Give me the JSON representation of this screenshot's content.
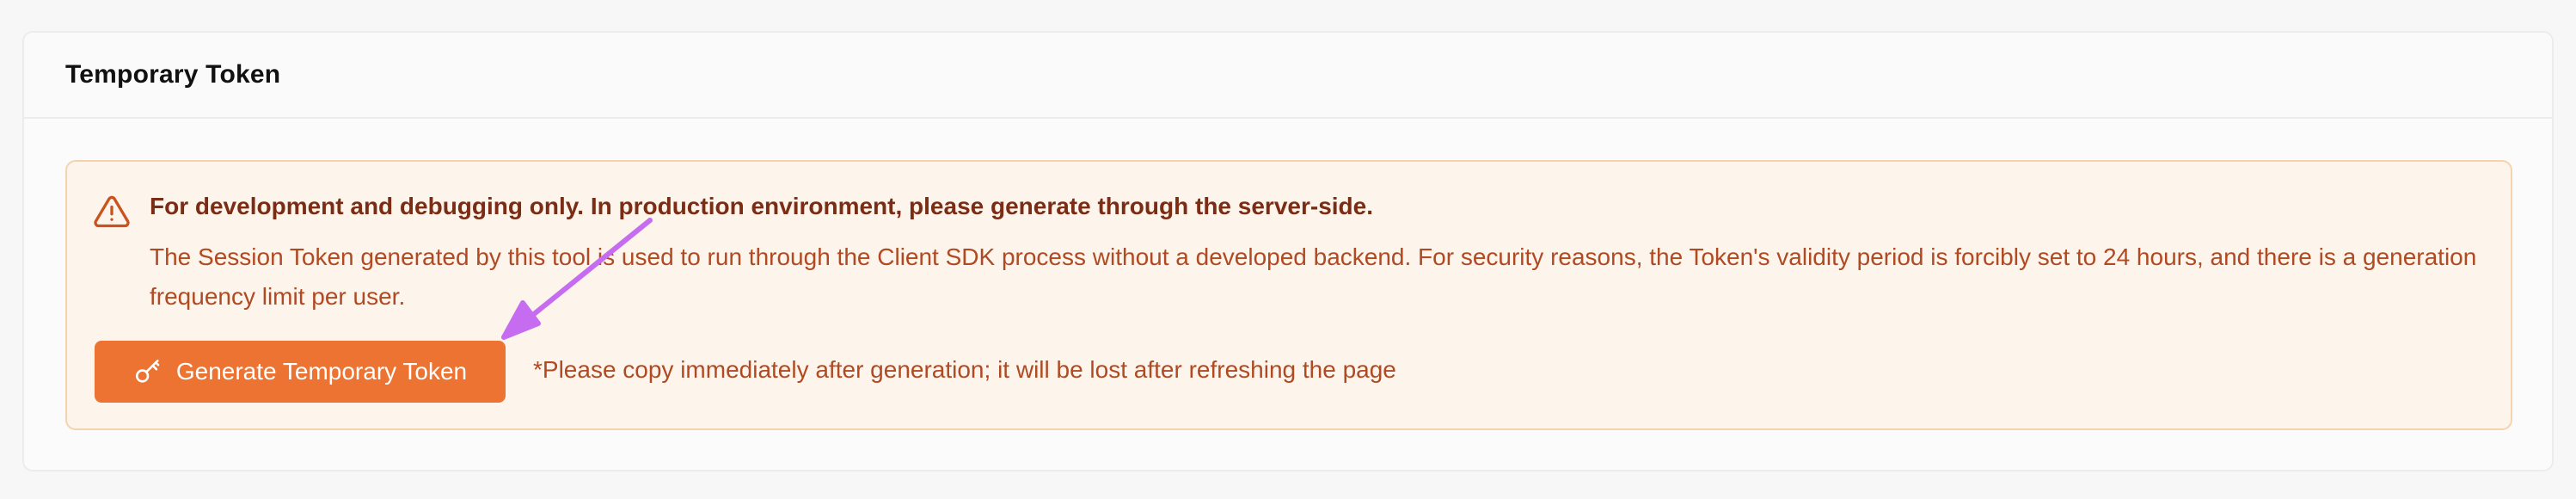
{
  "card": {
    "title": "Temporary Token"
  },
  "alert": {
    "icon": "warning-triangle-icon",
    "heading": "For development and debugging only. In production environment, please generate through the server-side.",
    "body": "The Session Token generated by this tool is used to run through the Client SDK process without a developed backend. For security reasons, the Token's validity period is forcibly set to 24 hours, and there is a generation frequency limit per user."
  },
  "actions": {
    "generate_button": {
      "label": "Generate Temporary Token",
      "icon": "key-icon"
    },
    "note": "*Please copy immediately after generation; it will be lost after refreshing the page"
  },
  "colors": {
    "accent": "#ec7331",
    "alert_background": "#fdf4ec",
    "alert_border": "#f5d3ac",
    "alert_text": "#b04a22",
    "annotation_arrow": "#c56cf0"
  }
}
